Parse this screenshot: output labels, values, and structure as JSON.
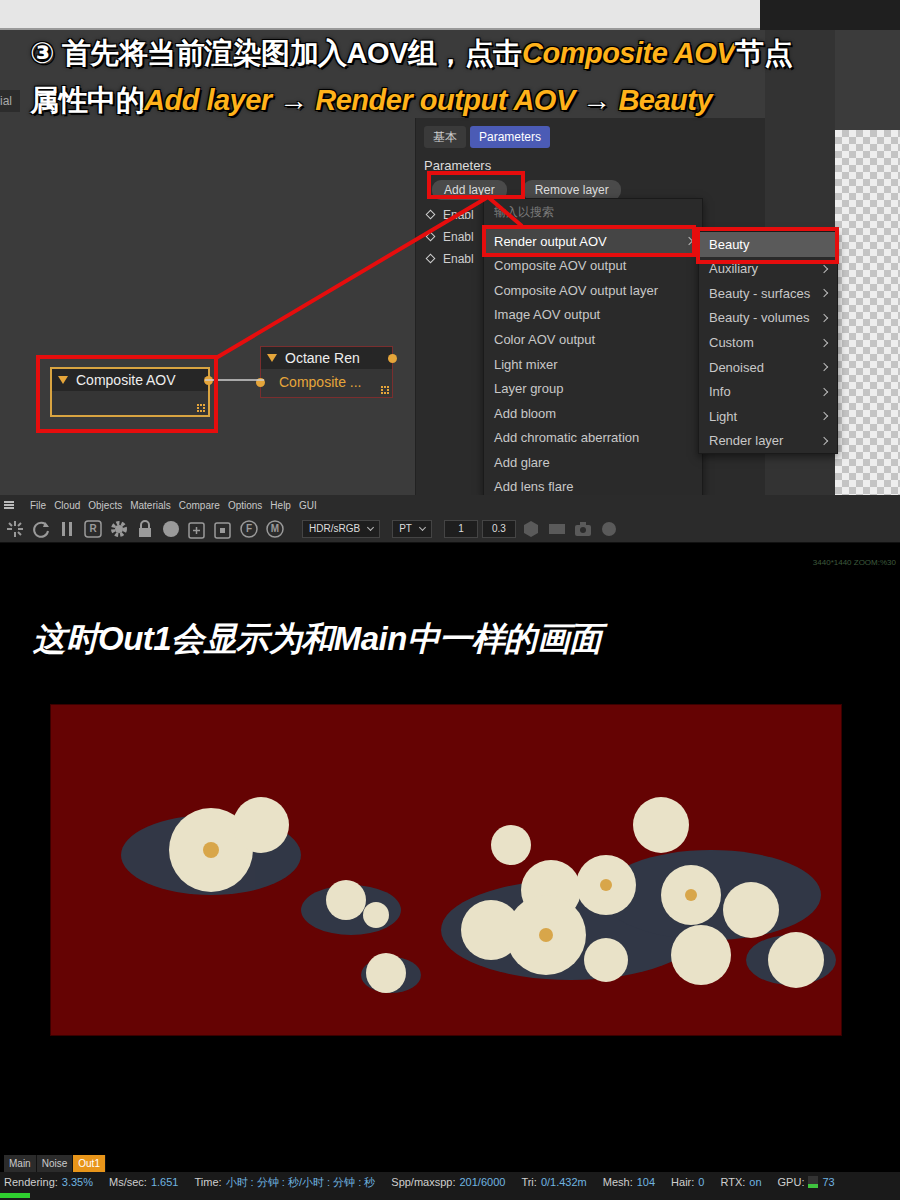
{
  "annotation": {
    "title_lines": [
      [
        {
          "text": "③ 首先将当前渲染图加入AOV组，点击",
          "highlight": false
        },
        {
          "text": "Composite AOV",
          "highlight": true
        },
        {
          "text": "节点",
          "highlight": false
        }
      ],
      [
        {
          "text": "属性中的",
          "highlight": false
        },
        {
          "text": "Add layer",
          "highlight": true
        },
        {
          "text": " → ",
          "highlight": false
        },
        {
          "text": "Render output AOV",
          "highlight": true
        },
        {
          "text": " → ",
          "highlight": false
        },
        {
          "text": "Beauty",
          "highlight": true
        }
      ]
    ],
    "caption": "这时Out1会显示为和Main中一样的画面"
  },
  "editor": {
    "left_tab_label": "ial"
  },
  "nodes": [
    {
      "title": "Composite AOV",
      "selected": true,
      "input": ""
    },
    {
      "title": "Octane Ren",
      "selected": false,
      "input": "Composite ..."
    }
  ],
  "properties": {
    "tabs": [
      {
        "label": "基本",
        "selected": false
      },
      {
        "label": "Parameters",
        "selected": true
      }
    ],
    "heading": "Parameters",
    "buttons": [
      "Add layer",
      "Remove layer"
    ],
    "rows": [
      "Enabl",
      "Enabl",
      "Enabl"
    ]
  },
  "context_menu": {
    "search_placeholder": "输入以搜索",
    "items": [
      {
        "label": "Render output AOV",
        "selected": true,
        "has_submenu": true
      },
      {
        "label": "Composite AOV output",
        "selected": false,
        "has_submenu": false
      },
      {
        "label": "Composite AOV output layer",
        "selected": false,
        "has_submenu": false
      },
      {
        "label": "Image AOV output",
        "selected": false,
        "has_submenu": false
      },
      {
        "label": "Color AOV output",
        "selected": false,
        "has_submenu": false
      },
      {
        "label": "Light mixer",
        "selected": false,
        "has_submenu": false
      },
      {
        "label": "Layer group",
        "selected": false,
        "has_submenu": false
      },
      {
        "label": "Add bloom",
        "selected": false,
        "has_submenu": false
      },
      {
        "label": "Add chromatic aberration",
        "selected": false,
        "has_submenu": false
      },
      {
        "label": "Add glare",
        "selected": false,
        "has_submenu": false
      },
      {
        "label": "Add lens flare",
        "selected": false,
        "has_submenu": false
      }
    ]
  },
  "submenu": {
    "items": [
      {
        "label": "Beauty",
        "selected": true,
        "has_submenu": false
      },
      {
        "label": "Auxiliary",
        "selected": false,
        "has_submenu": true
      },
      {
        "label": "Beauty - surfaces",
        "selected": false,
        "has_submenu": true
      },
      {
        "label": "Beauty - volumes",
        "selected": false,
        "has_submenu": true
      },
      {
        "label": "Custom",
        "selected": false,
        "has_submenu": true
      },
      {
        "label": "Denoised",
        "selected": false,
        "has_submenu": true
      },
      {
        "label": "Info",
        "selected": false,
        "has_submenu": true
      },
      {
        "label": "Light",
        "selected": false,
        "has_submenu": true
      },
      {
        "label": "Render layer",
        "selected": false,
        "has_submenu": true
      }
    ]
  },
  "menubar": {
    "items": [
      "File",
      "Cloud",
      "Objects",
      "Materials",
      "Compare",
      "Options",
      "Help",
      "GUI"
    ]
  },
  "toolbar": {
    "icons": [
      {
        "kind": "spark",
        "glyph": ""
      },
      {
        "kind": "refresh",
        "glyph": ""
      },
      {
        "kind": "pause",
        "glyph": ""
      },
      {
        "kind": "letter-box",
        "glyph": "R"
      },
      {
        "kind": "gear",
        "glyph": ""
      },
      {
        "kind": "lock",
        "glyph": ""
      },
      {
        "kind": "sphere",
        "glyph": ""
      },
      {
        "kind": "plus-box",
        "glyph": ""
      },
      {
        "kind": "dot-box",
        "glyph": ""
      },
      {
        "kind": "letter-circle",
        "glyph": "F"
      },
      {
        "kind": "letter-circle",
        "glyph": "M"
      }
    ],
    "fields": [
      {
        "value": "HDR/sRGB",
        "kind": "select"
      },
      {
        "value": "PT",
        "kind": "select"
      },
      {
        "value": "1",
        "kind": "input"
      },
      {
        "value": "0.3",
        "kind": "input"
      }
    ],
    "trailing_icons": [
      {
        "kind": "hex"
      },
      {
        "kind": "film"
      },
      {
        "kind": "camera"
      },
      {
        "kind": "dot"
      }
    ]
  },
  "viewer": {
    "resolution_text": "3440*1440 ZOOM:%30"
  },
  "viewer_tabs": [
    {
      "label": "Main",
      "selected": false
    },
    {
      "label": "Noise",
      "selected": false
    },
    {
      "label": "Out1",
      "selected": true
    }
  ],
  "status_bar": {
    "items": [
      {
        "label": "Rendering:",
        "value": "3.35%"
      },
      {
        "label": "Ms/sec:",
        "value": "1.651"
      },
      {
        "label": "Time:",
        "value": "小时 : 分钟 : 秒/小时 : 分钟 : 秒"
      },
      {
        "label": "Spp/maxspp:",
        "value": "201/6000"
      },
      {
        "label": "Tri:",
        "value": "0/1.432m"
      },
      {
        "label": "Mesh:",
        "value": "104"
      },
      {
        "label": "Hair:",
        "value": "0"
      },
      {
        "label": "RTX:",
        "value": "on"
      }
    ],
    "gpu_label": "GPU:",
    "gpu_level": 0.3,
    "gpu_value": "73"
  },
  "progress": {
    "level": 0.0335
  }
}
